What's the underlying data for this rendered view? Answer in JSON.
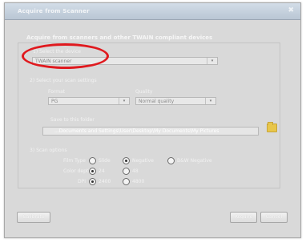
{
  "window": {
    "title": "Acquire from Scanner",
    "close_glyph": "✖"
  },
  "heading": "Acquire from scanners and other TWAIN compliant devices",
  "device": {
    "label": "1) Select the device",
    "value": "TWAIN scanner"
  },
  "scan_settings": {
    "label": "2) Select your scan settings",
    "format_label": "Format",
    "format_value": "PG",
    "quality_label": "Quality",
    "quality_value": "Normal quality"
  },
  "save_path": {
    "label": "Save to this folder",
    "value": "...Documents and Settings\\User\\Desktop\\My Documents\\My Pictures"
  },
  "scan_options": {
    "label": "3) Scan options",
    "film_type": {
      "label": "Film Type",
      "options": [
        "Slide",
        "Negative",
        "B&W Negative"
      ],
      "selected": "Negative"
    },
    "color_depth": {
      "label": "Color depth",
      "options": [
        "24",
        "48"
      ],
      "selected": "24"
    },
    "dpi": {
      "label": "DPI",
      "options": [
        "2400",
        "4800"
      ],
      "selected": "2400"
    }
  },
  "buttons": {
    "calibrate": "Calibrate",
    "acquire": "Acquire",
    "cancel": "Cancel"
  },
  "icons": {
    "dropdown": "▾"
  }
}
